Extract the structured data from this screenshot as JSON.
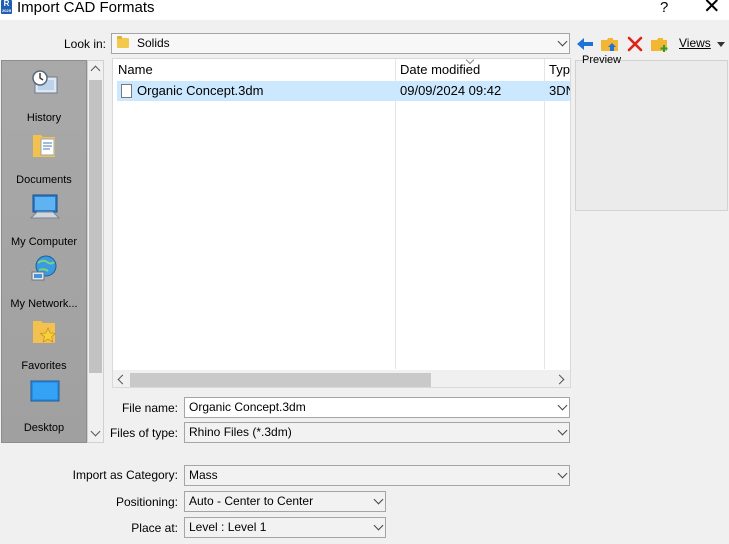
{
  "window": {
    "title": "Import CAD Formats",
    "help_label": "?",
    "close_label": "✕",
    "app_icon_text": "R",
    "app_icon_subtext": "2025"
  },
  "look_in": {
    "label": "Look in:",
    "value": "Solids"
  },
  "toolbar": {
    "back_icon": "back-arrow-icon",
    "up_folder_icon": "up-folder-icon",
    "delete_icon": "delete-icon",
    "new_folder_icon": "new-folder-icon",
    "views_label": "Views"
  },
  "places": [
    {
      "label": "History",
      "icon": "history-icon"
    },
    {
      "label": "Documents",
      "icon": "documents-icon"
    },
    {
      "label": "My Computer",
      "icon": "computer-icon"
    },
    {
      "label": "My Network...",
      "icon": "network-icon"
    },
    {
      "label": "Favorites",
      "icon": "favorites-icon"
    },
    {
      "label": "Desktop",
      "icon": "desktop-icon"
    }
  ],
  "file_list": {
    "columns": [
      "Name",
      "Date modified",
      "Typ"
    ],
    "rows": [
      {
        "name": "Organic Concept.3dm",
        "date": "09/09/2024 09:42",
        "type": "3DN"
      }
    ]
  },
  "preview": {
    "label": "Preview"
  },
  "file_name": {
    "label": "File name:",
    "value": "Organic Concept.3dm"
  },
  "files_of_type": {
    "label": "Files of type:",
    "value": "Rhino Files (*.3dm)"
  },
  "import_category": {
    "label": "Import as Category:",
    "value": "Mass"
  },
  "positioning": {
    "label": "Positioning:",
    "value": "Auto - Center to Center"
  },
  "place_at": {
    "label": "Place at:",
    "value": "Level : Level 1"
  }
}
